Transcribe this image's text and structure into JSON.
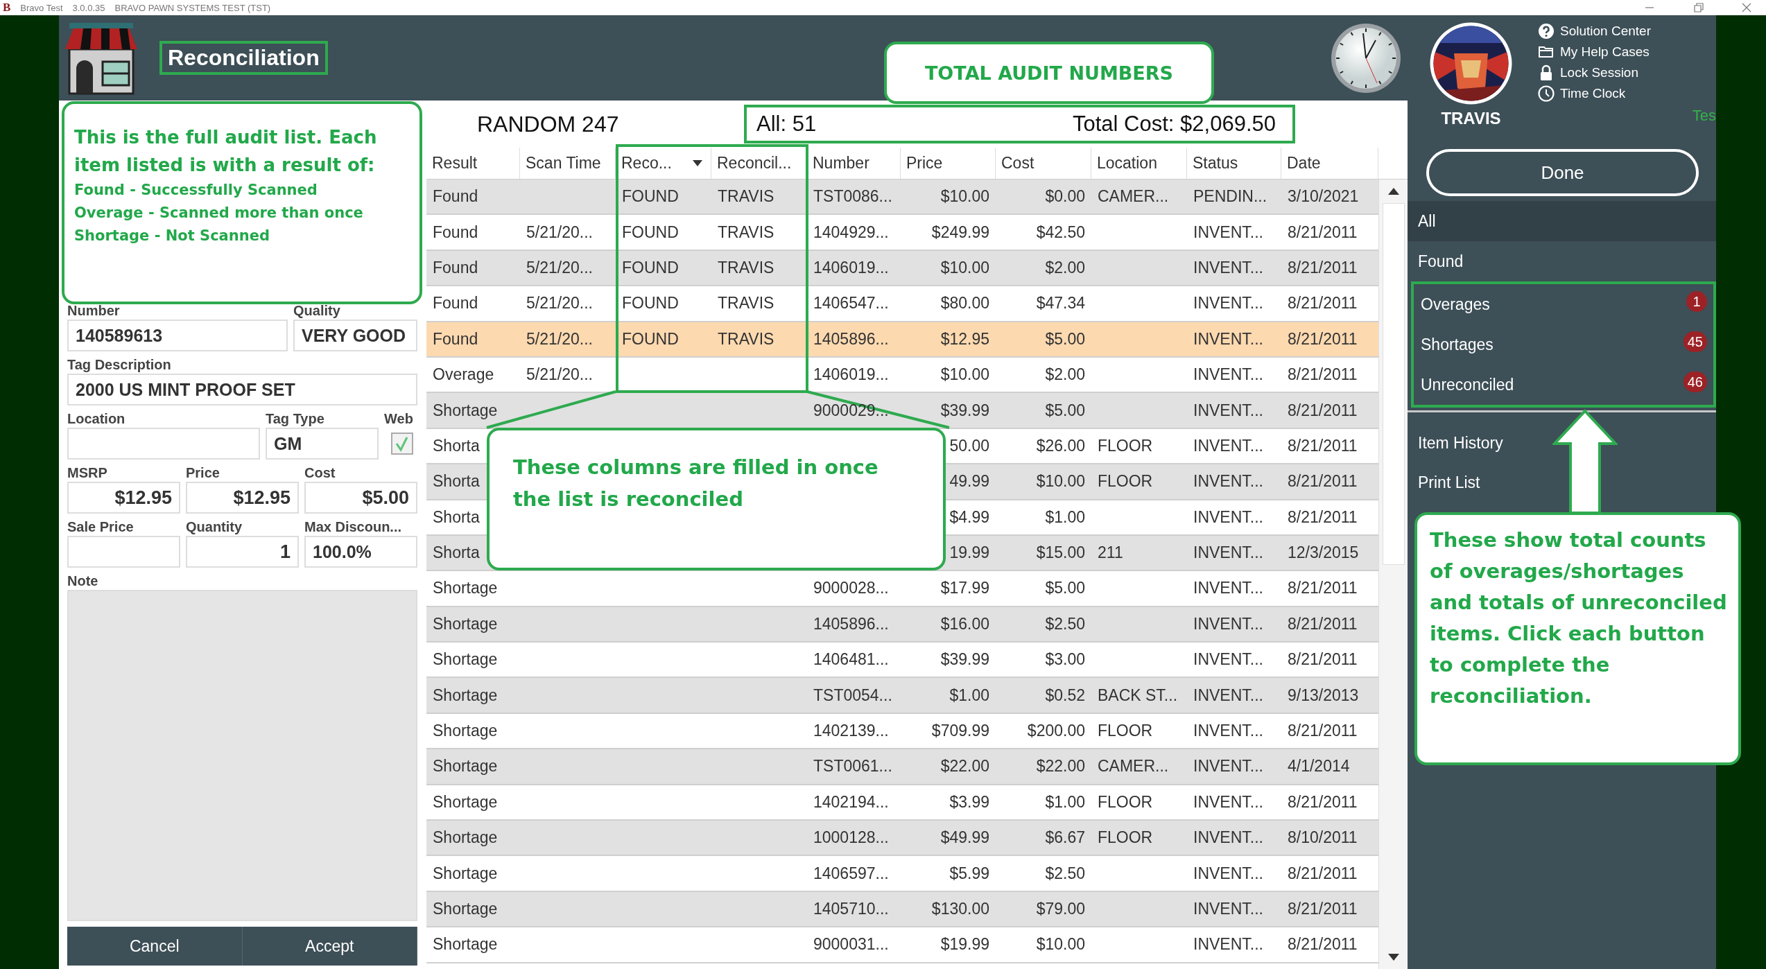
{
  "window": {
    "logo": "B",
    "app_name": "Bravo Test",
    "version": "3.0.0.35",
    "title": "BRAVO PAWN SYSTEMS TEST (TST)"
  },
  "header": {
    "title": "Reconciliation",
    "user": "TRAVIS",
    "status_text": "Tes",
    "links": [
      {
        "label": "Solution Center",
        "kind": "help"
      },
      {
        "label": "My Help Cases",
        "kind": "folder"
      },
      {
        "label": "Lock Session",
        "kind": "lock"
      },
      {
        "label": "Time Clock",
        "kind": "clock"
      }
    ]
  },
  "form": {
    "rows": [
      [
        {
          "label": "Number",
          "value": "140589613",
          "kind": "text"
        },
        {
          "label": "Quality",
          "value": "VERY GOOD",
          "kind": "text"
        }
      ],
      [
        {
          "label": "Tag Description",
          "value": "2000  US MINT PROOF SET",
          "kind": "text"
        }
      ],
      [
        {
          "label": "Location",
          "kind": "text"
        },
        {
          "label": "Tag Type",
          "value": "GM",
          "kind": "text"
        },
        {
          "label": "Web",
          "kind": "checkbox",
          "checked": true
        }
      ],
      [
        {
          "label": "MSRP",
          "value": "$12.95",
          "kind": "amount"
        },
        {
          "label": "Price",
          "value": "$12.95",
          "kind": "amount"
        },
        {
          "label": "Cost",
          "value": "$5.00",
          "kind": "amount"
        }
      ],
      [
        {
          "label": "Sale Price",
          "kind": "amount"
        },
        {
          "label": "Quantity",
          "value": "1",
          "kind": "amount"
        },
        {
          "label": "Max Discoun...",
          "value": "100.0%",
          "kind": "text"
        }
      ],
      [
        {
          "label": "Note",
          "kind": "note"
        }
      ]
    ],
    "buttons": [
      "Cancel",
      "Accept"
    ]
  },
  "audit": {
    "name": "RANDOM 247",
    "all": "All: 51",
    "total_cost": "Total Cost: $2,069.50"
  },
  "table": {
    "columns": [
      {
        "label": "Result"
      },
      {
        "label": "Scan Time"
      },
      {
        "label": "Reco...",
        "sorted": true
      },
      {
        "label": "Reconcil..."
      },
      {
        "label": "Number"
      },
      {
        "label": "Price"
      },
      {
        "label": "Cost"
      },
      {
        "label": "Location"
      },
      {
        "label": "Status"
      },
      {
        "label": "Date"
      }
    ],
    "rows": [
      {
        "selected": false,
        "cells": [
          "Found",
          "",
          "FOUND",
          "TRAVIS",
          "TST0086...",
          "$10.00",
          "$0.00",
          "CAMER...",
          "PENDIN...",
          "3/10/2021"
        ]
      },
      {
        "selected": false,
        "cells": [
          "Found",
          "5/21/20...",
          "FOUND",
          "TRAVIS",
          "1404929...",
          "$249.99",
          "$42.50",
          "",
          "INVENT...",
          "8/21/2011"
        ]
      },
      {
        "selected": false,
        "cells": [
          "Found",
          "5/21/20...",
          "FOUND",
          "TRAVIS",
          "1406019...",
          "$10.00",
          "$2.00",
          "",
          "INVENT...",
          "8/21/2011"
        ]
      },
      {
        "selected": false,
        "cells": [
          "Found",
          "5/21/20...",
          "FOUND",
          "TRAVIS",
          "1406547...",
          "$80.00",
          "$47.34",
          "",
          "INVENT...",
          "8/21/2011"
        ]
      },
      {
        "selected": true,
        "cells": [
          "Found",
          "5/21/20...",
          "FOUND",
          "TRAVIS",
          "1405896...",
          "$12.95",
          "$5.00",
          "",
          "INVENT...",
          "8/21/2011"
        ]
      },
      {
        "selected": false,
        "cells": [
          "Overage",
          "5/21/20...",
          "",
          "",
          "1406019...",
          "$10.00",
          "$2.00",
          "",
          "INVENT...",
          "8/21/2011"
        ]
      },
      {
        "selected": false,
        "cells": [
          "Shortage",
          "",
          "",
          "",
          "9000029...",
          "$39.99",
          "$5.00",
          "",
          "INVENT...",
          "8/21/2011"
        ]
      },
      {
        "selected": false,
        "cells": [
          "Shorta",
          "",
          "",
          "",
          "",
          "50.00",
          "$26.00",
          "FLOOR",
          "INVENT...",
          "8/21/2011"
        ]
      },
      {
        "selected": false,
        "cells": [
          "Shorta",
          "",
          "",
          "",
          "",
          "49.99",
          "$10.00",
          "FLOOR",
          "INVENT...",
          "8/21/2011"
        ]
      },
      {
        "selected": false,
        "cells": [
          "Shorta",
          "",
          "",
          "",
          "",
          "$4.99",
          "$1.00",
          "",
          "INVENT...",
          "8/21/2011"
        ]
      },
      {
        "selected": false,
        "cells": [
          "Shorta",
          "",
          "",
          "",
          "",
          "19.99",
          "$15.00",
          "211",
          "INVENT...",
          "12/3/2015"
        ]
      },
      {
        "selected": false,
        "cells": [
          "Shortage",
          "",
          "",
          "",
          "9000028...",
          "$17.99",
          "$5.00",
          "",
          "INVENT...",
          "8/21/2011"
        ]
      },
      {
        "selected": false,
        "cells": [
          "Shortage",
          "",
          "",
          "",
          "1405896...",
          "$16.00",
          "$2.50",
          "",
          "INVENT...",
          "8/21/2011"
        ]
      },
      {
        "selected": false,
        "cells": [
          "Shortage",
          "",
          "",
          "",
          "1406481...",
          "$39.99",
          "$3.00",
          "",
          "INVENT...",
          "8/21/2011"
        ]
      },
      {
        "selected": false,
        "cells": [
          "Shortage",
          "",
          "",
          "",
          "TST0054...",
          "$1.00",
          "$0.52",
          "BACK ST...",
          "INVENT...",
          "9/13/2013"
        ]
      },
      {
        "selected": false,
        "cells": [
          "Shortage",
          "",
          "",
          "",
          "1402139...",
          "$709.99",
          "$200.00",
          "FLOOR",
          "INVENT...",
          "8/21/2011"
        ]
      },
      {
        "selected": false,
        "cells": [
          "Shortage",
          "",
          "",
          "",
          "TST0061...",
          "$22.00",
          "$22.00",
          "CAMER...",
          "INVENT...",
          "4/1/2014"
        ]
      },
      {
        "selected": false,
        "cells": [
          "Shortage",
          "",
          "",
          "",
          "1402194...",
          "$3.99",
          "$1.00",
          "FLOOR",
          "INVENT...",
          "8/21/2011"
        ]
      },
      {
        "selected": false,
        "cells": [
          "Shortage",
          "",
          "",
          "",
          "1000128...",
          "$49.99",
          "$6.67",
          "FLOOR",
          "INVENT...",
          "8/10/2011"
        ]
      },
      {
        "selected": false,
        "cells": [
          "Shortage",
          "",
          "",
          "",
          "1406597...",
          "$5.99",
          "$2.50",
          "",
          "INVENT...",
          "8/21/2011"
        ]
      },
      {
        "selected": false,
        "cells": [
          "Shortage",
          "",
          "",
          "",
          "1405710...",
          "$130.00",
          "$79.00",
          "",
          "INVENT...",
          "8/21/2011"
        ]
      },
      {
        "selected": false,
        "cells": [
          "Shortage",
          "",
          "",
          "",
          "9000031...",
          "$19.99",
          "$10.00",
          "",
          "INVENT...",
          "8/21/2011"
        ]
      }
    ]
  },
  "sidebar": {
    "done": "Done",
    "items": [
      {
        "label": "All",
        "selected": true
      },
      {
        "label": "Found",
        "selected": false
      },
      {
        "label": "Overages",
        "selected": false,
        "badge": "1"
      },
      {
        "label": "Shortages",
        "selected": false,
        "badge": "45"
      },
      {
        "label": "Unreconciled",
        "selected": false,
        "badge": "46"
      }
    ],
    "actions": [
      "Item History",
      "Print List"
    ]
  },
  "callouts": [
    {
      "kind": "audit-list",
      "heading": "This is the full audit list. Each item listed is with a result of:",
      "lines": [
        "Found - Successfully Scanned",
        "Overage - Scanned more than once",
        "Shortage - Not Scanned"
      ]
    },
    {
      "kind": "totals",
      "text": "TOTAL AUDIT NUMBERS"
    },
    {
      "kind": "columns",
      "text": "These columns are filled in once the list is reconciled"
    },
    {
      "kind": "counts",
      "text": "These show total counts of overages/shortages and totals of unreconciled items. Click each button to complete the reconciliation."
    }
  ]
}
